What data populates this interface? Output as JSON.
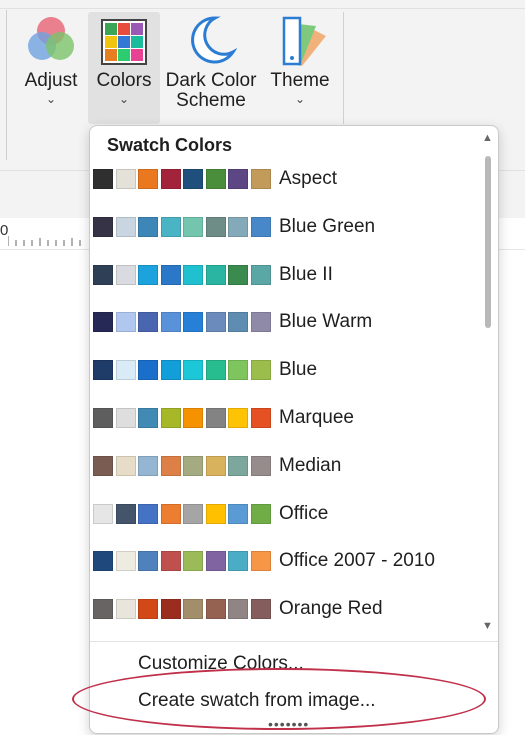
{
  "ribbon": {
    "buttons": [
      {
        "id": "adjust",
        "label": "Adjust",
        "chevron": "⌄"
      },
      {
        "id": "colors",
        "label": "Colors",
        "chevron": "⌄"
      },
      {
        "id": "dark",
        "label": "Dark Color",
        "label2": "Scheme"
      },
      {
        "id": "theme",
        "label": "Theme",
        "chevron": "⌄"
      }
    ],
    "ruler_zero": "0"
  },
  "dropdown": {
    "title": "Swatch Colors",
    "swatches": [
      {
        "name": "Aspect",
        "colors": [
          "#2f2f2f",
          "#e4e1d9",
          "#e9781f",
          "#a3243a",
          "#1f4f7c",
          "#4a8e3c",
          "#5c4683",
          "#c29a5a"
        ]
      },
      {
        "name": "Blue Green",
        "colors": [
          "#353345",
          "#c9d6e2",
          "#3d87b8",
          "#4ab3c4",
          "#74c5ad",
          "#6e8d86",
          "#84a9b8",
          "#4888c9"
        ]
      },
      {
        "name": "Blue II",
        "colors": [
          "#2e3f56",
          "#d9dbe0",
          "#1ca2dd",
          "#2b78c9",
          "#1fc0d0",
          "#29b5a1",
          "#3a8b4d",
          "#5aa7a6"
        ]
      },
      {
        "name": "Blue Warm",
        "colors": [
          "#262856",
          "#b0c8f0",
          "#4a66b1",
          "#5992d8",
          "#2680d8",
          "#6a8bbb",
          "#5e8db1",
          "#8f8aa8"
        ]
      },
      {
        "name": "Blue",
        "colors": [
          "#1f3b67",
          "#d8ebf7",
          "#1a6fcb",
          "#129ed8",
          "#1cc8d8",
          "#28bd8f",
          "#7ec55e",
          "#9bbd4c"
        ]
      },
      {
        "name": "Marquee",
        "colors": [
          "#5e5e5e",
          "#dedede",
          "#418ab3",
          "#a6b727",
          "#f69100",
          "#838383",
          "#fec305",
          "#e55123"
        ]
      },
      {
        "name": "Median",
        "colors": [
          "#7a5c52",
          "#e7dcc8",
          "#94b6d2",
          "#dd8047",
          "#a5ab81",
          "#d8b25c",
          "#7ba79d",
          "#968c8c"
        ]
      },
      {
        "name": "Office",
        "colors": [
          "#e7e6e6",
          "#44546a",
          "#4472c4",
          "#ed7d31",
          "#a5a5a5",
          "#ffc000",
          "#5b9bd5",
          "#70ad47"
        ]
      },
      {
        "name": "Office 2007 - 2010",
        "colors": [
          "#1f497d",
          "#eeece1",
          "#4f81bd",
          "#c0504d",
          "#9bbb59",
          "#8064a2",
          "#4bacc6",
          "#f79646"
        ]
      },
      {
        "name": "Orange Red",
        "colors": [
          "#696464",
          "#e9e5dc",
          "#d34817",
          "#9b2d1f",
          "#a28e6a",
          "#956251",
          "#918485",
          "#855d5d"
        ]
      }
    ],
    "customize_label": "Customize Colors...",
    "create_label": "Create swatch from image...",
    "grip": "•••••••"
  },
  "colors": {
    "highlight": "#c0304a",
    "ribbon_bg": "#f3f3f3",
    "active_button": "#e1e1e1"
  }
}
